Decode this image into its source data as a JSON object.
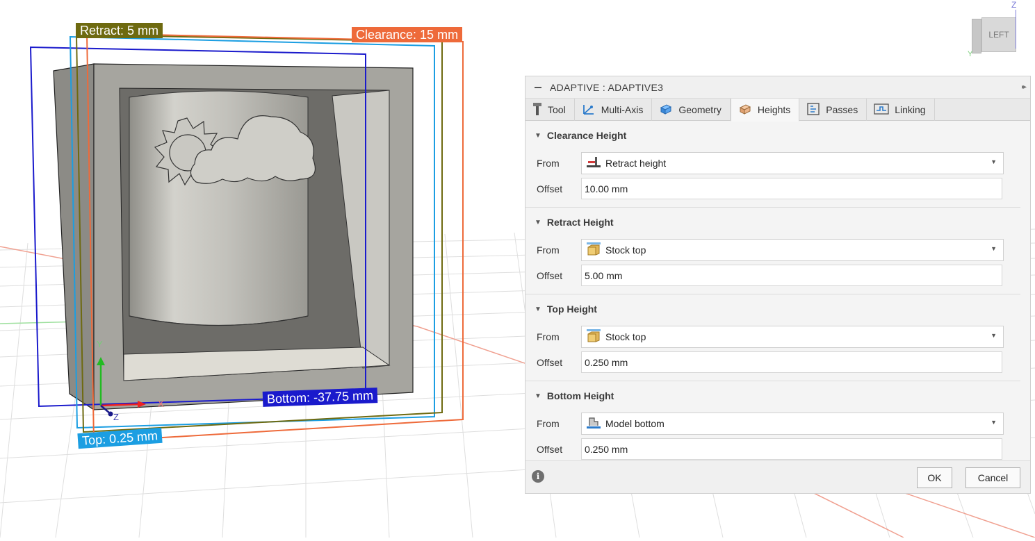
{
  "viewport": {
    "labels": {
      "retract": "Retract: 5 mm",
      "clearance": "Clearance: 15 mm",
      "bottom": "Bottom: -37.75 mm",
      "top": "Top: 0.25 mm"
    },
    "axes": {
      "x": "X",
      "z": "Z",
      "y": "Y"
    },
    "colors": {
      "retract": "#6e6a10",
      "clearance": "#ee6a3a",
      "bottom": "#1a1acc",
      "top": "#1b9ee2"
    }
  },
  "viewcube": {
    "face_label": "LEFT",
    "z_axis": "Z",
    "y_axis": "Y"
  },
  "panel": {
    "title": "ADAPTIVE : ADAPTIVE3",
    "tabs": [
      {
        "label": "Tool",
        "icon": "tool-icon"
      },
      {
        "label": "Multi-Axis",
        "icon": "multi-axis-icon"
      },
      {
        "label": "Geometry",
        "icon": "geometry-icon"
      },
      {
        "label": "Heights",
        "icon": "heights-icon",
        "active": true
      },
      {
        "label": "Passes",
        "icon": "passes-icon"
      },
      {
        "label": "Linking",
        "icon": "linking-icon"
      }
    ],
    "sections": [
      {
        "title": "Clearance Height",
        "from_label": "From",
        "from_value": "Retract height",
        "from_icon": "retract-height-icon",
        "offset_label": "Offset",
        "offset_value": "10.00 mm"
      },
      {
        "title": "Retract Height",
        "from_label": "From",
        "from_value": "Stock top",
        "from_icon": "stock-top-icon",
        "offset_label": "Offset",
        "offset_value": "5.00 mm"
      },
      {
        "title": "Top Height",
        "from_label": "From",
        "from_value": "Stock top",
        "from_icon": "stock-top-icon",
        "offset_label": "Offset",
        "offset_value": "0.250 mm"
      },
      {
        "title": "Bottom Height",
        "from_label": "From",
        "from_value": "Model bottom",
        "from_icon": "model-bottom-icon",
        "offset_label": "Offset",
        "offset_value": "0.250 mm"
      }
    ],
    "footer": {
      "ok": "OK",
      "cancel": "Cancel",
      "info_icon": "i"
    }
  }
}
